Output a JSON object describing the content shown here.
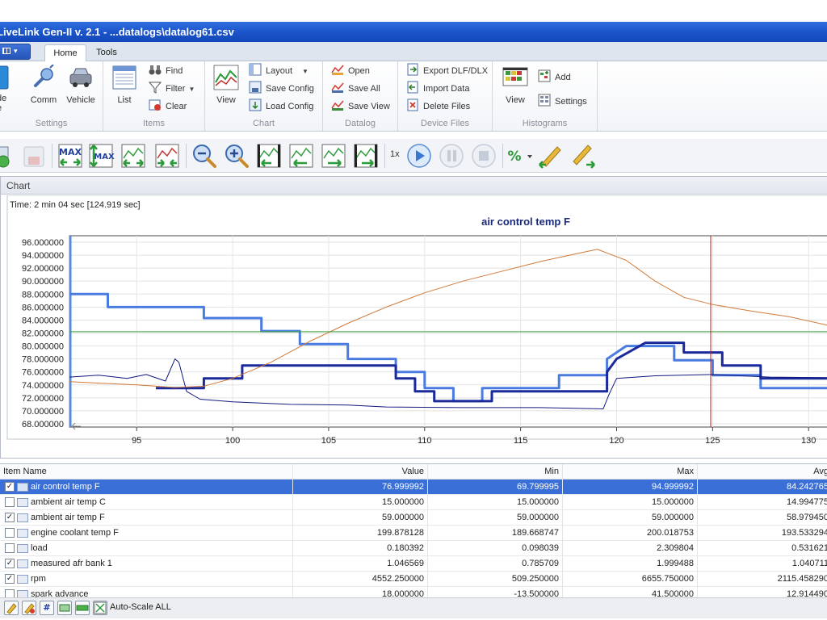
{
  "window": {
    "title": "LiveLink Gen-II  v. 2.1 - ...datalogs\\datalog61.csv"
  },
  "tabs": [
    {
      "label": "Home",
      "active": true
    },
    {
      "label": "Tools",
      "active": false
    }
  ],
  "ribbon": {
    "groups": [
      {
        "label": "Settings",
        "buttons": [
          "Comm",
          "Vehicle"
        ],
        "partial": [
          "de",
          "e"
        ]
      },
      {
        "label": "Items",
        "buttons": [
          "List"
        ],
        "small": [
          "Find",
          "Filter",
          "Clear"
        ]
      },
      {
        "label": "Chart",
        "buttons": [
          "View"
        ],
        "small": [
          "Layout",
          "Save Config",
          "Load Config"
        ]
      },
      {
        "label": "Datalog",
        "small": [
          "Open",
          "Save All",
          "Save View"
        ]
      },
      {
        "label": "Device Files",
        "small": [
          "Export DLF/DLX",
          "Import Data",
          "Delete Files"
        ]
      },
      {
        "label": "Histograms",
        "buttons": [
          "View"
        ],
        "small": [
          "Add",
          "Settings"
        ]
      }
    ]
  },
  "toolbar": {
    "speed": "1x"
  },
  "chart_panel": {
    "header": "Chart",
    "time_readout": "Time: 2 min 04 sec [124.919 sec]"
  },
  "chart_data": {
    "type": "line",
    "title": "air control temp F",
    "xlim": [
      91.5,
      131
    ],
    "ylim": [
      67.5,
      97
    ],
    "x_ticks": [
      95,
      100,
      105,
      110,
      115,
      120,
      125,
      130
    ],
    "y_ticks": [
      "96.000000",
      "94.000000",
      "92.000000",
      "90.000000",
      "88.000000",
      "86.000000",
      "84.000000",
      "82.000000",
      "80.000000",
      "78.000000",
      "76.000000",
      "74.000000",
      "72.000000",
      "70.000000",
      "68.000000"
    ],
    "cursor_x": 124.9,
    "reference_line_y": 82.2,
    "series": [
      {
        "color": "#4a7be0",
        "width": 3,
        "points": [
          [
            91.5,
            88
          ],
          [
            93.5,
            88
          ],
          [
            93.5,
            86
          ],
          [
            98.5,
            86
          ],
          [
            98.5,
            84.3
          ],
          [
            101.5,
            84.3
          ],
          [
            101.5,
            82.3
          ],
          [
            103.5,
            82.3
          ],
          [
            103.5,
            80.3
          ],
          [
            106,
            80.3
          ],
          [
            106,
            78
          ],
          [
            108.5,
            78
          ],
          [
            108.5,
            76
          ],
          [
            110,
            76
          ],
          [
            110,
            73.5
          ],
          [
            111.5,
            73.5
          ],
          [
            111.5,
            71.5
          ],
          [
            113,
            71.5
          ],
          [
            113,
            73.5
          ],
          [
            117,
            73.5
          ],
          [
            117,
            75.5
          ],
          [
            119.5,
            75.5
          ],
          [
            119.5,
            78
          ],
          [
            120.5,
            80
          ],
          [
            123,
            80
          ],
          [
            123,
            77.8
          ],
          [
            125,
            77.8
          ],
          [
            125,
            75.5
          ],
          [
            127.5,
            75.5
          ],
          [
            127.5,
            73.5
          ],
          [
            131,
            73.5
          ]
        ]
      },
      {
        "color": "#1a2a9a",
        "width": 3,
        "points": [
          [
            96,
            73.5
          ],
          [
            98.5,
            73.5
          ],
          [
            98.5,
            75
          ],
          [
            100.5,
            75
          ],
          [
            100.5,
            77
          ],
          [
            108.5,
            77
          ],
          [
            108.5,
            75
          ],
          [
            109.5,
            75
          ],
          [
            109.5,
            73
          ],
          [
            110.5,
            73
          ],
          [
            110.5,
            71.5
          ],
          [
            113.5,
            71.5
          ],
          [
            113.5,
            73
          ],
          [
            119.5,
            73
          ],
          [
            119.5,
            76
          ],
          [
            120,
            78
          ],
          [
            121.5,
            80.5
          ],
          [
            123.5,
            80.5
          ],
          [
            123.5,
            79
          ],
          [
            125.5,
            79
          ],
          [
            125.5,
            77
          ],
          [
            127.5,
            77
          ],
          [
            127.5,
            75
          ],
          [
            131,
            75
          ]
        ]
      },
      {
        "color": "#101880",
        "width": 1,
        "points": [
          [
            91.5,
            75.2
          ],
          [
            93,
            75.5
          ],
          [
            94.5,
            75
          ],
          [
            95.5,
            75.6
          ],
          [
            96.5,
            74.6
          ],
          [
            97,
            78
          ],
          [
            97.2,
            77.5
          ],
          [
            97.6,
            73
          ],
          [
            98.3,
            71.8
          ],
          [
            100,
            71.4
          ],
          [
            103,
            71
          ],
          [
            106,
            70.9
          ],
          [
            108,
            70.6
          ],
          [
            112,
            70.5
          ],
          [
            116,
            70.5
          ],
          [
            119.3,
            70.3
          ],
          [
            119.6,
            72.5
          ],
          [
            120,
            75
          ],
          [
            122,
            75.4
          ],
          [
            125,
            75.6
          ],
          [
            128,
            75.2
          ],
          [
            131,
            75.1
          ]
        ]
      },
      {
        "color": "#d07a3a",
        "width": 1,
        "points": [
          [
            91.5,
            74.5
          ],
          [
            95,
            74
          ],
          [
            97,
            73.6
          ],
          [
            98.5,
            73.8
          ],
          [
            100,
            75
          ],
          [
            102,
            77.5
          ],
          [
            104,
            80.7
          ],
          [
            106,
            83.5
          ],
          [
            108,
            86
          ],
          [
            110,
            88.2
          ],
          [
            112,
            90
          ],
          [
            114,
            91.5
          ],
          [
            116,
            93
          ],
          [
            118,
            94.3
          ],
          [
            119,
            94.9
          ],
          [
            120.5,
            93.2
          ],
          [
            122,
            90
          ],
          [
            123.5,
            87.5
          ],
          [
            125,
            86.4
          ],
          [
            127,
            85.4
          ],
          [
            129,
            84.5
          ],
          [
            131,
            83.2
          ]
        ]
      },
      {
        "color": "#3aa03a",
        "width": 1,
        "points": [
          [
            91.5,
            82.2
          ],
          [
            131,
            82.2
          ]
        ]
      }
    ]
  },
  "table": {
    "columns": [
      "Item Name",
      "Value",
      "Min",
      "Max",
      "Avg"
    ],
    "rows": [
      {
        "checked": true,
        "selected": true,
        "name": "air control temp F",
        "value": "76.999992",
        "min": "69.799995",
        "max": "94.999992",
        "avg": "84.242765"
      },
      {
        "checked": false,
        "selected": false,
        "name": "ambient air temp C",
        "value": "15.000000",
        "min": "15.000000",
        "max": "15.000000",
        "avg": "14.994775"
      },
      {
        "checked": true,
        "selected": false,
        "name": "ambient air temp F",
        "value": "59.000000",
        "min": "59.000000",
        "max": "59.000000",
        "avg": "58.979450"
      },
      {
        "checked": false,
        "selected": false,
        "name": "engine coolant temp F",
        "value": "199.878128",
        "min": "189.668747",
        "max": "200.018753",
        "avg": "193.533294"
      },
      {
        "checked": false,
        "selected": false,
        "name": "load",
        "value": "0.180392",
        "min": "0.098039",
        "max": "2.309804",
        "avg": "0.531621"
      },
      {
        "checked": true,
        "selected": false,
        "name": "measured afr bank 1",
        "value": "1.046569",
        "min": "0.785709",
        "max": "1.999488",
        "avg": "1.040711"
      },
      {
        "checked": true,
        "selected": false,
        "name": "rpm",
        "value": "4552.250000",
        "min": "509.250000",
        "max": "6655.750000",
        "avg": "2115.458290"
      },
      {
        "checked": false,
        "selected": false,
        "name": "spark advance",
        "value": "18.000000",
        "min": "-13.500000",
        "max": "41.500000",
        "avg": "12.914490"
      }
    ]
  },
  "bottombar": {
    "autoscale_label": "Auto-Scale ALL"
  }
}
